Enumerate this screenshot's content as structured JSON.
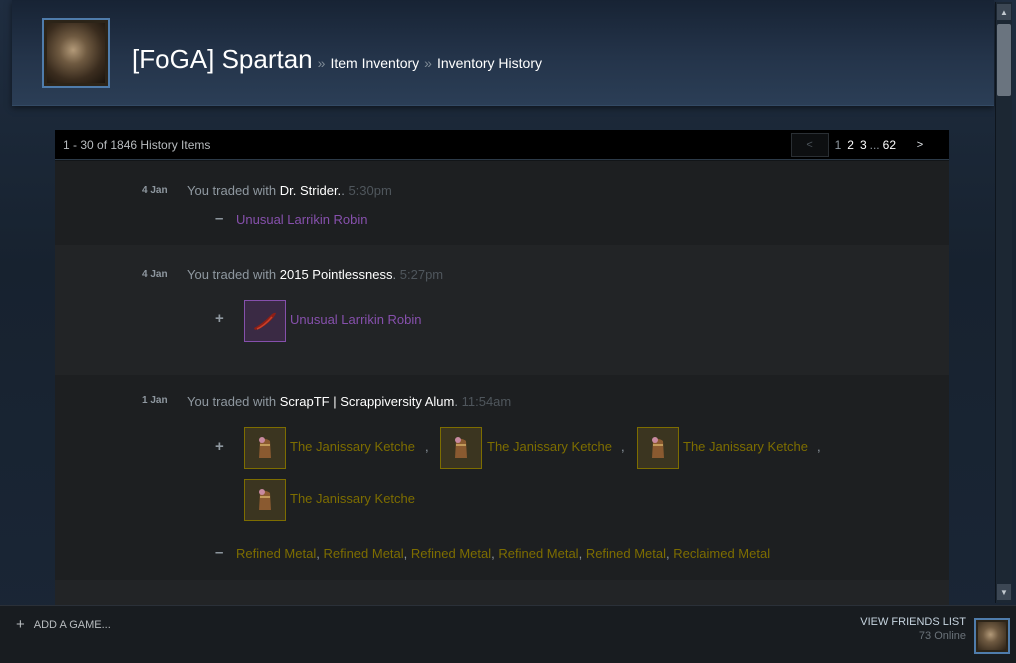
{
  "header": {
    "persona_name": "[FoGA] Spartan",
    "separator": "»",
    "crumbs": [
      "Item Inventory",
      "Inventory History"
    ]
  },
  "pager": {
    "summary": "1 - 30 of 1846 History Items",
    "prev": "<",
    "next": ">",
    "pages": [
      "1",
      "2",
      "3"
    ],
    "dots": "...",
    "last": "62"
  },
  "history": [
    {
      "date": "4 Jan",
      "prefix": "You traded with",
      "partner": "Dr. Strider.",
      "suffix": ".",
      "time": "5:30pm",
      "lost_sign": "–",
      "lost": "Unusual Larrikin Robin"
    },
    {
      "date": "4 Jan",
      "prefix": "You traded with",
      "partner": "2015 Pointlessness",
      "suffix": ".",
      "time": "5:27pm",
      "gained_sign": "+",
      "gained": "Unusual Larrikin Robin"
    },
    {
      "date": "1 Jan",
      "prefix": "You traded with",
      "partner": "ScrapTF | Scrappiversity Alum",
      "suffix": ".",
      "time": "11:54am",
      "gained_sign": "+",
      "gained": [
        "The Janissary Ketche",
        "The Janissary Ketche",
        "The Janissary Ketche",
        "The Janissary Ketche"
      ],
      "lost_sign": "–",
      "lost": [
        "Refined Metal",
        "Refined Metal",
        "Refined Metal",
        "Refined Metal",
        "Refined Metal",
        "Reclaimed Metal"
      ]
    }
  ],
  "footer": {
    "add_game_icon": "+",
    "add_game": "ADD A GAME...",
    "view_friends": "VIEW FRIENDS LIST",
    "online": "73 Online"
  },
  "icons": {
    "avatar": "avatar-portrait",
    "scroll_up": "scroll-up-arrow",
    "scroll_down": "scroll-down-arrow",
    "robin_hat": "larrikin-robin-hat",
    "ketche": "janissary-ketche-hat"
  },
  "colors": {
    "unusual": "#8650ac",
    "unique": "#7d6d00",
    "partner": "#ffffff",
    "background": "#1b2838"
  }
}
